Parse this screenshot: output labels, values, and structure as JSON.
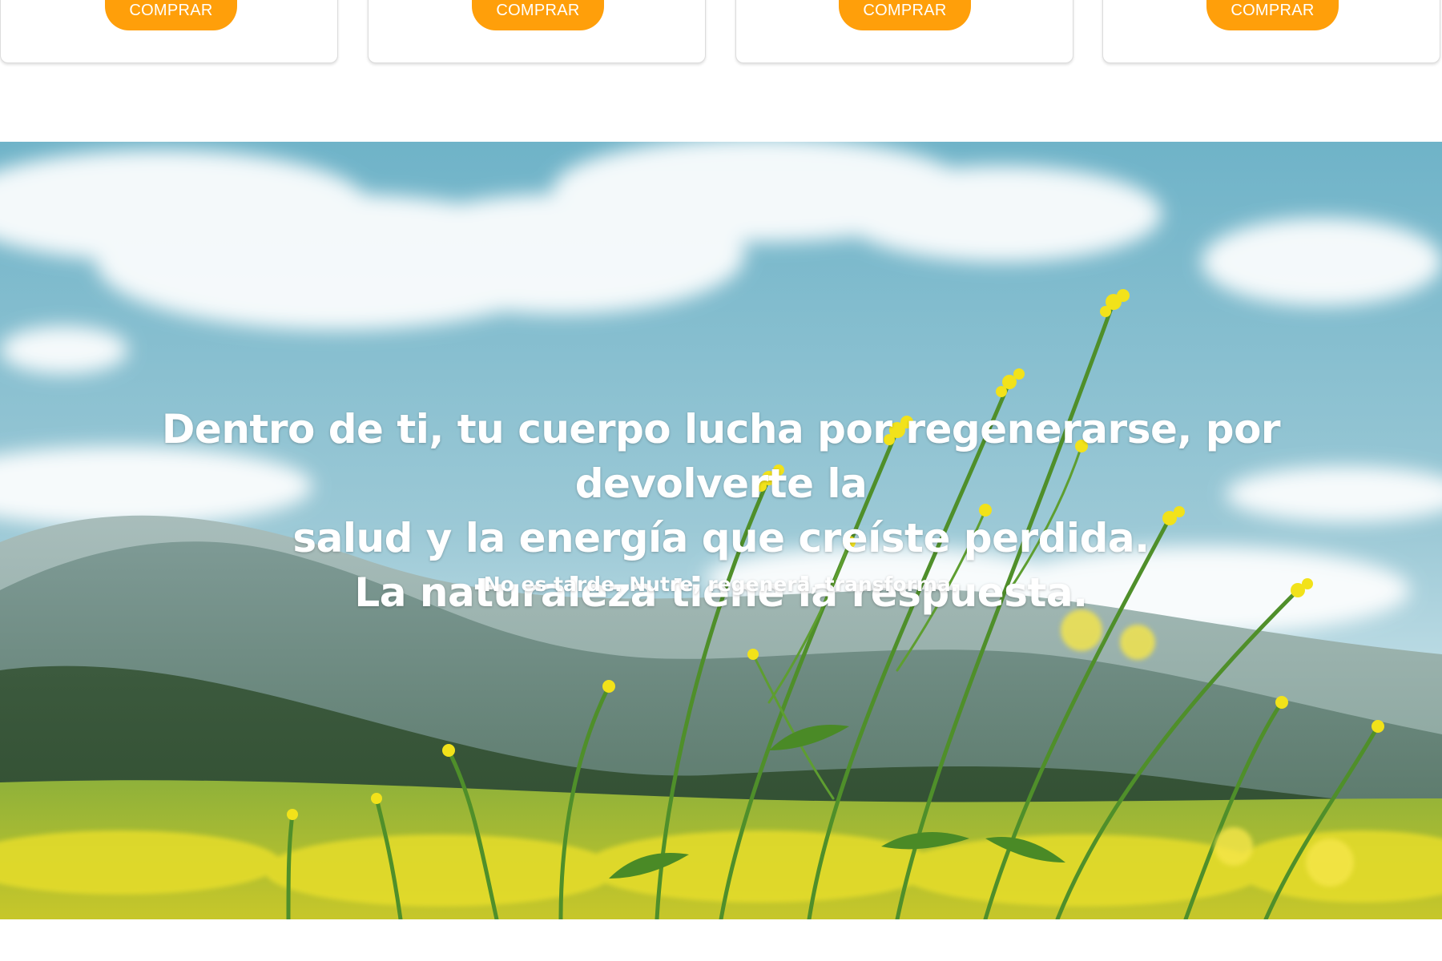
{
  "products": {
    "cards": [
      {
        "button_label": "COMPRAR"
      },
      {
        "button_label": "COMPRAR"
      },
      {
        "button_label": "COMPRAR"
      },
      {
        "button_label": "COMPRAR"
      }
    ]
  },
  "hero": {
    "headline_line1": "Dentro de ti, tu cuerpo lucha por regenerarse, por devolverte la",
    "headline_line2": "salud y la energía que creíste perdida.",
    "headline_line3": "La naturaleza tiene la respuesta.",
    "tagline": "No es tarde. Nutre, regenera, transforma.",
    "image": "meadow-with-yellow-wildflowers-mountains-sky"
  },
  "colors": {
    "button": "#ff9f0a",
    "button_text": "#ffffff",
    "hero_text": "#ffffff"
  }
}
